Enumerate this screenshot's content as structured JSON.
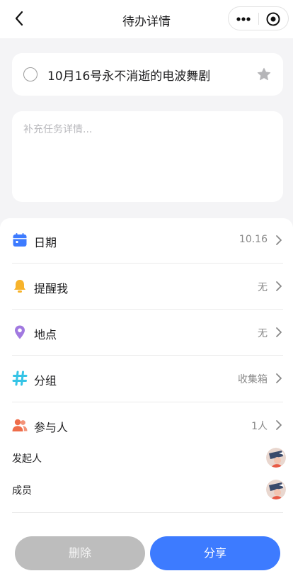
{
  "nav": {
    "title": "待办详情"
  },
  "task": {
    "title": "10月16号永不消逝的电波舞剧"
  },
  "details": {
    "placeholder": "补充任务详情..."
  },
  "rows": [
    {
      "label": "日期",
      "value": "10.16",
      "icon": "calendar-icon",
      "color": "#3d7bff"
    },
    {
      "label": "提醒我",
      "value": "无",
      "icon": "bell-icon",
      "color": "#f7b32b"
    },
    {
      "label": "地点",
      "value": "无",
      "icon": "location-pin-icon",
      "color": "#a179e0"
    },
    {
      "label": "分组",
      "value": "收集箱",
      "icon": "hash-icon",
      "color": "#35c4e6"
    },
    {
      "label": "参与人",
      "value": "1人",
      "icon": "people-icon",
      "color": "#ef6d4a"
    }
  ],
  "participants": {
    "initiator_label": "发起人",
    "member_label": "成员"
  },
  "buttons": {
    "delete": "删除",
    "share": "分享"
  },
  "colors": {
    "accent": "#3d7bff",
    "disabled": "#bdbdbd"
  }
}
